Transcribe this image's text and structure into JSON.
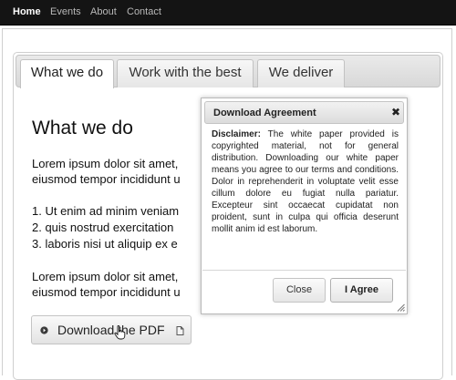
{
  "nav": {
    "items": [
      {
        "label": "Home",
        "active": true
      },
      {
        "label": "Events",
        "active": false
      },
      {
        "label": "About",
        "active": false
      },
      {
        "label": "Contact",
        "active": false
      }
    ]
  },
  "tabs": [
    {
      "label": "What we do",
      "active": true
    },
    {
      "label": "Work with the best",
      "active": false
    },
    {
      "label": "We deliver",
      "active": false
    }
  ],
  "content": {
    "heading": "What we do",
    "para1": [
      "Lorem ipsum dolor sit amet, ",
      "eiusmod tempor incididunt u"
    ],
    "list": [
      "1. Ut enim ad minim veniam",
      "2. quis nostrud exercitation",
      "3. laboris nisi ut aliquip ex e"
    ],
    "para2": [
      "Lorem ipsum dolor sit amet, ",
      "eiusmod tempor incididunt u"
    ],
    "download_label": "Download the PDF"
  },
  "dialog": {
    "title": "Download Agreement",
    "close_glyph": "✖",
    "disclaimer_label": "Disclaimer:",
    "body": " The white paper provided is copyrighted material, not for general distribution. Downloading our white paper means you agree to our terms and conditions. Dolor in reprehenderit in voluptate velit esse cillum dolore eu fugiat nulla pariatur. Excepteur sint occaecat cupidatat non proident, sunt in culpa qui officia deserunt mollit anim id est laborum.",
    "close_label": "Close",
    "agree_label": "I Agree"
  },
  "icons": {
    "download": "arrow-circle-icon",
    "external": "document-icon",
    "cursor": "hand-pointer-icon",
    "resize": "resize-grip-icon"
  }
}
